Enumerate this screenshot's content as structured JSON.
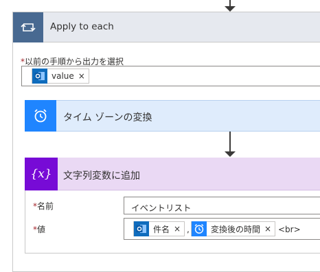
{
  "apply_to_each": {
    "title": "Apply to each",
    "field_required_mark": "*",
    "field_label": "以前の手順から出力を選択",
    "token": {
      "label": "value",
      "remove": "×",
      "icon": "outlook-icon"
    }
  },
  "timezone_action": {
    "title": "タイム ゾーンの変換",
    "icon": "alarm-clock-icon"
  },
  "append_action": {
    "title": "文字列変数に追加",
    "icon_text": "{x}",
    "name_field": {
      "required_mark": "*",
      "label": "名前",
      "value": "イベントリスト"
    },
    "value_field": {
      "required_mark": "*",
      "label": "値",
      "tokens": [
        {
          "label": "件名",
          "remove": "×",
          "icon": "outlook-icon"
        },
        {
          "label": "変換後の時間",
          "remove": "×",
          "icon": "alarm-clock-icon"
        }
      ],
      "separator": ",",
      "suffix_text": "<br>"
    }
  },
  "colors": {
    "loop_accent": "#486991",
    "timezone_accent": "#1f85ff",
    "variable_accent": "#770bd6",
    "outlook_blue": "#0f6cbd"
  }
}
